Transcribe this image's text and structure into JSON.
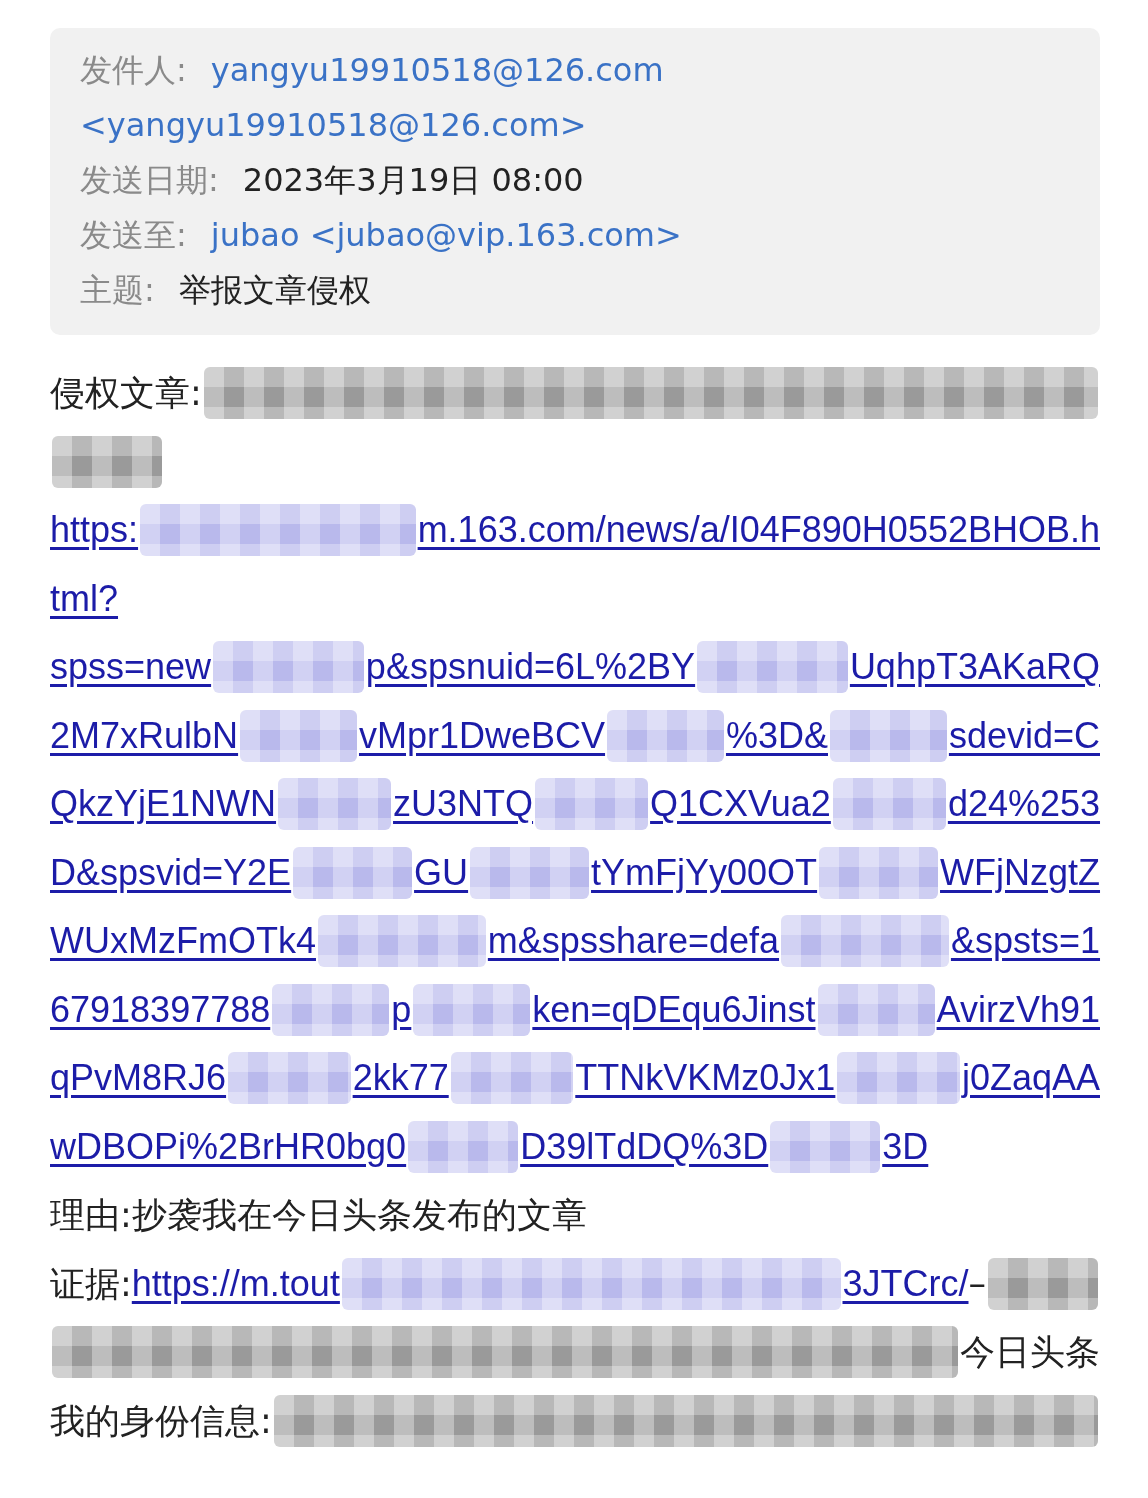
{
  "header": {
    "rows": [
      {
        "parts": [
          {
            "kind": "label",
            "text": "发件人:"
          },
          {
            "kind": "link",
            "text": "yangyu19910518@126.com"
          }
        ]
      },
      {
        "parts": [
          {
            "kind": "link",
            "text": "<yangyu19910518@126.com>"
          }
        ]
      },
      {
        "parts": [
          {
            "kind": "label",
            "text": "发送日期:"
          },
          {
            "kind": "text",
            "text": "2023年3月19日 08:00"
          }
        ]
      },
      {
        "parts": [
          {
            "kind": "label",
            "text": "发送至:"
          },
          {
            "kind": "link",
            "text": "jubao <jubao@vip.163.com>"
          }
        ]
      },
      {
        "parts": [
          {
            "kind": "label",
            "text": "主题:"
          },
          {
            "kind": "text",
            "text": "举报文章侵权"
          }
        ]
      }
    ]
  },
  "body": {
    "lines": [
      {
        "parts": [
          {
            "kind": "text",
            "text": "侵权文章:"
          },
          {
            "kind": "redaction",
            "color": "#9a9a9a"
          }
        ]
      },
      {
        "parts": [
          {
            "kind": "redaction",
            "color": "#9a9a9a",
            "short": true
          }
        ]
      },
      {
        "parts": [
          {
            "kind": "link",
            "text": "https:"
          },
          {
            "kind": "redaction",
            "color": "#b9b9ec"
          },
          {
            "kind": "link",
            "text": "m.163.com/news/a/I04F890H0552BHOB.h"
          }
        ]
      },
      {
        "parts": [
          {
            "kind": "link",
            "text": "tml?"
          }
        ]
      },
      {
        "parts": [
          {
            "kind": "link",
            "text": "spss=new"
          },
          {
            "kind": "redaction",
            "color": "#b9b9ec"
          },
          {
            "kind": "link",
            "text": "p&spsnuid=6L%2BY"
          },
          {
            "kind": "redaction",
            "color": "#b9b9ec"
          },
          {
            "kind": "link",
            "text": "UqhpT3AKaRQ"
          }
        ]
      },
      {
        "parts": [
          {
            "kind": "link",
            "text": "2M7xRulbN"
          },
          {
            "kind": "redaction",
            "color": "#b9b9ec"
          },
          {
            "kind": "link",
            "text": "vMpr1DweBCV"
          },
          {
            "kind": "redaction",
            "color": "#b9b9ec"
          },
          {
            "kind": "link",
            "text": "%3D&"
          },
          {
            "kind": "redaction",
            "color": "#b9b9ec"
          },
          {
            "kind": "link",
            "text": "sdevid=C"
          }
        ]
      },
      {
        "parts": [
          {
            "kind": "link",
            "text": "QkzYjE1NWN"
          },
          {
            "kind": "redaction",
            "color": "#b9b9ec"
          },
          {
            "kind": "link",
            "text": "zU3NTQ"
          },
          {
            "kind": "redaction",
            "color": "#b9b9ec"
          },
          {
            "kind": "link",
            "text": "Q1CXVua2"
          },
          {
            "kind": "redaction",
            "color": "#b9b9ec"
          },
          {
            "kind": "link",
            "text": "d24%253"
          }
        ]
      },
      {
        "parts": [
          {
            "kind": "link",
            "text": "D&spsvid=Y2E"
          },
          {
            "kind": "redaction",
            "color": "#b9b9ec"
          },
          {
            "kind": "link",
            "text": "GU"
          },
          {
            "kind": "redaction",
            "color": "#b9b9ec"
          },
          {
            "kind": "link",
            "text": "tYmFjYy00OT"
          },
          {
            "kind": "redaction",
            "color": "#b9b9ec"
          },
          {
            "kind": "link",
            "text": "WFjNzgtZ"
          }
        ]
      },
      {
        "parts": [
          {
            "kind": "link",
            "text": "WUxMzFmOTk4"
          },
          {
            "kind": "redaction",
            "color": "#b9b9ec"
          },
          {
            "kind": "link",
            "text": "m&spsshare=defa"
          },
          {
            "kind": "redaction",
            "color": "#b9b9ec"
          },
          {
            "kind": "link",
            "text": "&spsts=1"
          }
        ]
      },
      {
        "parts": [
          {
            "kind": "link",
            "text": "67918397788"
          },
          {
            "kind": "redaction",
            "color": "#b9b9ec"
          },
          {
            "kind": "link",
            "text": "p"
          },
          {
            "kind": "redaction",
            "color": "#b9b9ec"
          },
          {
            "kind": "link",
            "text": "ken=qDEqu6Jinst"
          },
          {
            "kind": "redaction",
            "color": "#b9b9ec"
          },
          {
            "kind": "link",
            "text": "AvirzVh91"
          }
        ]
      },
      {
        "parts": [
          {
            "kind": "link",
            "text": "qPvM8RJ6"
          },
          {
            "kind": "redaction",
            "color": "#b9b9ec"
          },
          {
            "kind": "link",
            "text": "2kk77"
          },
          {
            "kind": "redaction",
            "color": "#b9b9ec"
          },
          {
            "kind": "link",
            "text": "TTNkVKMz0Jx1"
          },
          {
            "kind": "redaction",
            "color": "#b9b9ec"
          },
          {
            "kind": "link",
            "text": "j0ZaqAA"
          }
        ]
      },
      {
        "parts": [
          {
            "kind": "link",
            "text": "wDBOPi%2BrHR0bg0"
          },
          {
            "kind": "redaction",
            "color": "#b9b9ec",
            "short": true
          },
          {
            "kind": "link",
            "text": "D39lTdDQ%3D"
          },
          {
            "kind": "redaction",
            "color": "#b9b9ec",
            "short": true
          },
          {
            "kind": "link",
            "text": "3D"
          }
        ]
      },
      {
        "parts": [
          {
            "kind": "text",
            "text": "理由:抄袭我在今日头条发布的文章"
          }
        ]
      },
      {
        "parts": [
          {
            "kind": "text",
            "text": "证据:"
          },
          {
            "kind": "link",
            "text": "https://m.tout"
          },
          {
            "kind": "redaction",
            "color": "#b9b9ec"
          },
          {
            "kind": "link",
            "text": "3JTCrc/"
          },
          {
            "kind": "text",
            "text": "–"
          },
          {
            "kind": "redaction",
            "color": "#9a9a9a",
            "short": true
          }
        ]
      },
      {
        "parts": [
          {
            "kind": "redaction",
            "color": "#9a9a9a"
          },
          {
            "kind": "text",
            "text": "今日头条"
          }
        ]
      },
      {
        "parts": [
          {
            "kind": "text",
            "text": "我的身份信息:"
          },
          {
            "kind": "redaction",
            "color": "#9a9a9a"
          }
        ]
      }
    ]
  }
}
